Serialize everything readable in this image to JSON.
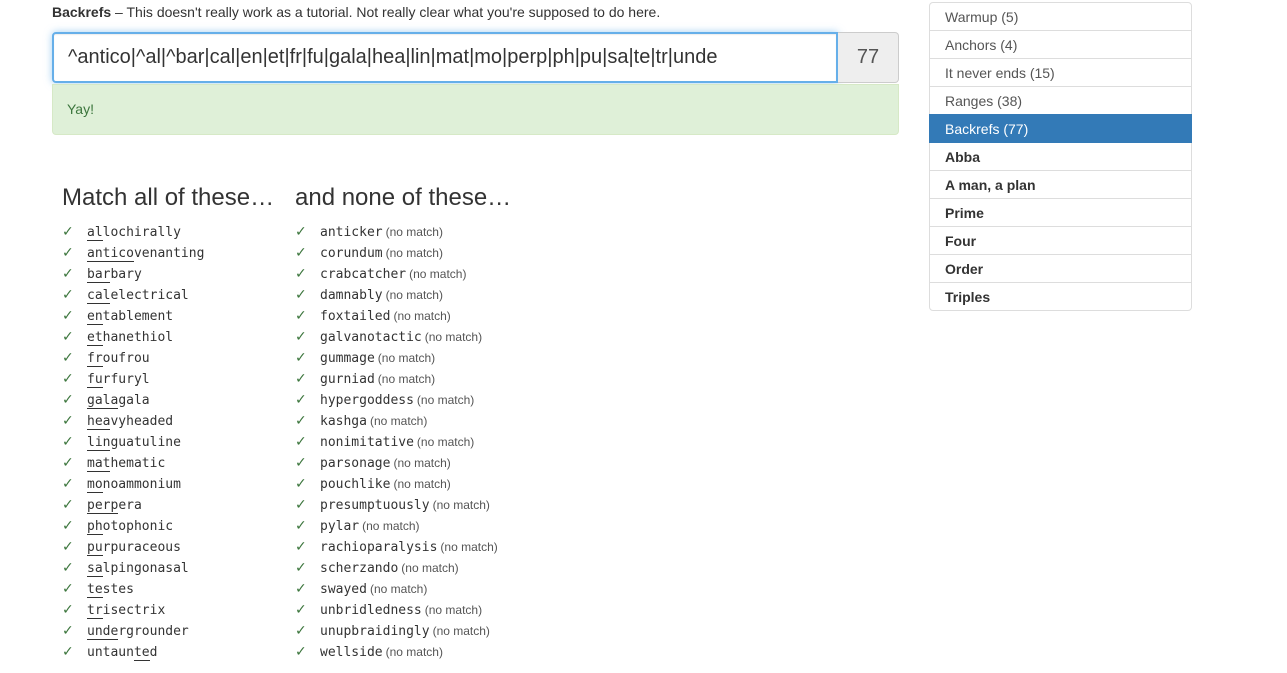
{
  "header": {
    "title": "Backrefs",
    "separator": "–",
    "description": "This doesn't really work as a tutorial. Not really clear what you're supposed to do here."
  },
  "regex": {
    "value": "^antico|^al|^bar|cal|en|et|fr|fu|gala|hea|lin|mat|mo|perp|ph|pu|sa|te|tr|unde",
    "score": "77"
  },
  "alert": {
    "text": "Yay!"
  },
  "colors": {
    "accent": "#337ab7",
    "success_bg": "#dff0d8",
    "success_text": "#3c763d",
    "focus": "#66afe9"
  },
  "match": {
    "heading": "Match all of these…",
    "items": [
      {
        "check": "✓",
        "hl": "al",
        "rest": "lochirally",
        "pre": ""
      },
      {
        "check": "✓",
        "hl": "antico",
        "rest": "venanting",
        "pre": ""
      },
      {
        "check": "✓",
        "hl": "bar",
        "rest": "bary",
        "pre": ""
      },
      {
        "check": "✓",
        "hl": "cal",
        "rest": "electrical",
        "pre": ""
      },
      {
        "check": "✓",
        "hl": "en",
        "rest": "tablement",
        "pre": ""
      },
      {
        "check": "✓",
        "hl": "et",
        "rest": "hanethiol",
        "pre": ""
      },
      {
        "check": "✓",
        "hl": "fr",
        "rest": "oufrou",
        "pre": ""
      },
      {
        "check": "✓",
        "hl": "fu",
        "rest": "rfuryl",
        "pre": ""
      },
      {
        "check": "✓",
        "hl": "gala",
        "rest": "gala",
        "pre": ""
      },
      {
        "check": "✓",
        "hl": "hea",
        "rest": "vyheaded",
        "pre": ""
      },
      {
        "check": "✓",
        "hl": "lin",
        "rest": "guatuline",
        "pre": ""
      },
      {
        "check": "✓",
        "hl": "mat",
        "rest": "hematic",
        "pre": ""
      },
      {
        "check": "✓",
        "hl": "mo",
        "rest": "noammonium",
        "pre": ""
      },
      {
        "check": "✓",
        "hl": "perp",
        "rest": "era",
        "pre": ""
      },
      {
        "check": "✓",
        "hl": "ph",
        "rest": "otophonic",
        "pre": ""
      },
      {
        "check": "✓",
        "hl": "pu",
        "rest": "rpuraceous",
        "pre": ""
      },
      {
        "check": "✓",
        "hl": "sa",
        "rest": "lpingonasal",
        "pre": ""
      },
      {
        "check": "✓",
        "hl": "te",
        "rest": "stes",
        "pre": ""
      },
      {
        "check": "✓",
        "hl": "tr",
        "rest": "isectrix",
        "pre": ""
      },
      {
        "check": "✓",
        "hl": "unde",
        "rest": "rgrounder",
        "pre": ""
      },
      {
        "check": "✓",
        "hl": "te",
        "rest": "d",
        "pre": "untaun"
      }
    ]
  },
  "none": {
    "heading": "and none of these…",
    "no_match_label": "(no match)",
    "items": [
      {
        "check": "✓",
        "word": "anticker"
      },
      {
        "check": "✓",
        "word": "corundum"
      },
      {
        "check": "✓",
        "word": "crabcatcher"
      },
      {
        "check": "✓",
        "word": "damnably"
      },
      {
        "check": "✓",
        "word": "foxtailed"
      },
      {
        "check": "✓",
        "word": "galvanotactic"
      },
      {
        "check": "✓",
        "word": "gummage"
      },
      {
        "check": "✓",
        "word": "gurniad"
      },
      {
        "check": "✓",
        "word": "hypergoddess"
      },
      {
        "check": "✓",
        "word": "kashga"
      },
      {
        "check": "✓",
        "word": "nonimitative"
      },
      {
        "check": "✓",
        "word": "parsonage"
      },
      {
        "check": "✓",
        "word": "pouchlike"
      },
      {
        "check": "✓",
        "word": "presumptuously"
      },
      {
        "check": "✓",
        "word": "pylar"
      },
      {
        "check": "✓",
        "word": "rachioparalysis"
      },
      {
        "check": "✓",
        "word": "scherzando"
      },
      {
        "check": "✓",
        "word": "swayed"
      },
      {
        "check": "✓",
        "word": "unbridledness"
      },
      {
        "check": "✓",
        "word": "unupbraidingly"
      },
      {
        "check": "✓",
        "word": "wellside"
      }
    ]
  },
  "sidebar": {
    "items": [
      {
        "label": "Warmup (5)",
        "active": false,
        "bold": false
      },
      {
        "label": "Anchors (4)",
        "active": false,
        "bold": false
      },
      {
        "label": "It never ends (15)",
        "active": false,
        "bold": false
      },
      {
        "label": "Ranges (38)",
        "active": false,
        "bold": false
      },
      {
        "label": "Backrefs (77)",
        "active": true,
        "bold": false
      },
      {
        "label": "Abba",
        "active": false,
        "bold": true
      },
      {
        "label": "A man, a plan",
        "active": false,
        "bold": true
      },
      {
        "label": "Prime",
        "active": false,
        "bold": true
      },
      {
        "label": "Four",
        "active": false,
        "bold": true
      },
      {
        "label": "Order",
        "active": false,
        "bold": true
      },
      {
        "label": "Triples",
        "active": false,
        "bold": true
      }
    ]
  }
}
